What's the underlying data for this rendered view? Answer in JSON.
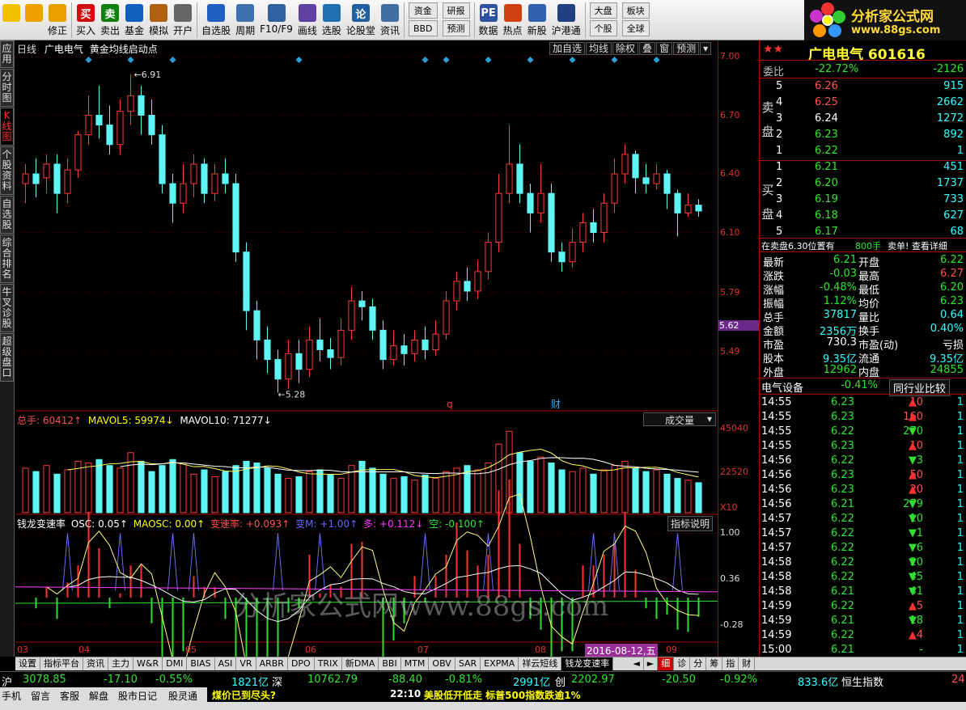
{
  "toolbar": {
    "buttons": [
      {
        "label": "",
        "icon": "start-grid-icon",
        "color": "#f2c200"
      },
      {
        "label": "",
        "icon": "back-arrow-icon",
        "color": "#f0a000"
      },
      {
        "label": "修正",
        "icon": "refresh-icon",
        "color": "#e8a000"
      },
      {
        "label": "买入",
        "icon": "buy-icon",
        "color": "#d01010",
        "glyph": "买"
      },
      {
        "label": "卖出",
        "icon": "sell-icon",
        "color": "#108010",
        "glyph": "卖"
      },
      {
        "label": "基金",
        "icon": "fund-icon",
        "color": "#1060c0"
      },
      {
        "label": "模拟",
        "icon": "hammer-icon",
        "color": "#b06010"
      },
      {
        "label": "开户",
        "icon": "lock-icon",
        "color": "#666"
      },
      {
        "label": "自选股",
        "icon": "star-folder-icon",
        "color": "#2060c0"
      },
      {
        "label": "周期",
        "icon": "clock-icon",
        "color": "#4070b0"
      },
      {
        "label": "F10/F9",
        "icon": "f10-icon",
        "color": "#3060a0"
      },
      {
        "label": "画线",
        "icon": "pen-icon",
        "color": "#6040a0"
      },
      {
        "label": "选股",
        "icon": "stock-pick-icon",
        "color": "#2070b0"
      },
      {
        "label": "论股堂",
        "icon": "forum-icon",
        "color": "#2060a0",
        "glyph": "论"
      },
      {
        "label": "资讯",
        "icon": "news-icon",
        "color": "#4070a0"
      }
    ],
    "small_buttons": [
      [
        "资金",
        "BBD"
      ],
      [
        "研报",
        "预测"
      ]
    ],
    "buttons2": [
      {
        "label": "数据",
        "icon": "pe-icon",
        "color": "#3050a0",
        "glyph": "PE"
      },
      {
        "label": "热点",
        "icon": "hot-icon",
        "color": "#d04010"
      },
      {
        "label": "新股",
        "icon": "new-stock-icon",
        "color": "#3060b0"
      },
      {
        "label": "沪港通",
        "icon": "hk-connect-icon",
        "color": "#204080"
      }
    ],
    "small_buttons2": [
      [
        "大盘",
        "个股"
      ],
      [
        "板块",
        "全球"
      ]
    ]
  },
  "logo": {
    "line1": "分析家公式网",
    "line2": "www.88gs.com"
  },
  "side_tabs": [
    "应用",
    "分时图",
    "K线图",
    "个股资料",
    "自选股",
    "综合排名",
    "牛叉诊股",
    "超级盘口"
  ],
  "chart_header": {
    "period": "日线",
    "stock": "广电电气",
    "formula": "黄金均线启动点"
  },
  "chart_buttons": [
    "加自选",
    "均线",
    "除权",
    "叠",
    "窗",
    "预测"
  ],
  "kline": {
    "high_label": "6.91",
    "low_label": "5.28",
    "price_axis": [
      "7.00",
      "6.70",
      "6.40",
      "6.10",
      "5.79",
      "5.49"
    ],
    "current_marker": "5.62",
    "event_q": "q",
    "event_cai": "财",
    "candles": [
      [
        6.35,
        6.4,
        6.45,
        6.25
      ],
      [
        6.4,
        6.35,
        6.48,
        6.28
      ],
      [
        6.38,
        6.45,
        6.5,
        6.3
      ],
      [
        6.45,
        6.3,
        6.5,
        6.2
      ],
      [
        6.3,
        6.42,
        6.48,
        6.25
      ],
      [
        6.42,
        6.6,
        6.62,
        6.38
      ],
      [
        6.6,
        6.7,
        6.8,
        6.55
      ],
      [
        6.7,
        6.65,
        6.85,
        6.58
      ],
      [
        6.65,
        6.55,
        6.75,
        6.5
      ],
      [
        6.55,
        6.72,
        6.78,
        6.5
      ],
      [
        6.72,
        6.8,
        6.91,
        6.65
      ],
      [
        6.8,
        6.7,
        6.85,
        6.6
      ],
      [
        6.7,
        6.6,
        6.78,
        6.55
      ],
      [
        6.6,
        6.35,
        6.65,
        6.3
      ],
      [
        6.35,
        6.25,
        6.4,
        6.15
      ],
      [
        6.25,
        6.35,
        6.45,
        6.2
      ],
      [
        6.35,
        6.45,
        6.5,
        6.28
      ],
      [
        6.45,
        6.3,
        6.48,
        6.25
      ],
      [
        6.3,
        6.4,
        6.45,
        6.26
      ],
      [
        6.4,
        6.35,
        6.48,
        6.3
      ],
      [
        6.35,
        6.0,
        6.4,
        5.95
      ],
      [
        6.0,
        5.7,
        6.05,
        5.6
      ],
      [
        5.7,
        5.55,
        5.75,
        5.45
      ],
      [
        5.55,
        5.45,
        5.62,
        5.38
      ],
      [
        5.45,
        5.35,
        5.5,
        5.28
      ],
      [
        5.35,
        5.48,
        5.55,
        5.3
      ],
      [
        5.48,
        5.4,
        5.55,
        5.33
      ],
      [
        5.4,
        5.55,
        5.62,
        5.36
      ],
      [
        5.55,
        5.5,
        5.66,
        5.44
      ],
      [
        5.5,
        5.46,
        5.56,
        5.4
      ],
      [
        5.46,
        5.6,
        5.66,
        5.42
      ],
      [
        5.6,
        5.75,
        5.82,
        5.55
      ],
      [
        5.75,
        5.72,
        5.8,
        5.65
      ],
      [
        5.72,
        5.6,
        5.76,
        5.55
      ],
      [
        5.6,
        5.45,
        5.65,
        5.4
      ],
      [
        5.45,
        5.52,
        5.6,
        5.42
      ],
      [
        5.52,
        5.48,
        5.58,
        5.42
      ],
      [
        5.48,
        5.55,
        5.6,
        5.44
      ],
      [
        5.55,
        5.5,
        5.62,
        5.45
      ],
      [
        5.5,
        5.58,
        5.65,
        5.47
      ],
      [
        5.58,
        5.75,
        5.8,
        5.55
      ],
      [
        5.75,
        5.85,
        5.9,
        5.7
      ],
      [
        5.85,
        5.8,
        5.92,
        5.75
      ],
      [
        5.8,
        5.9,
        5.96,
        5.76
      ],
      [
        5.9,
        6.05,
        6.1,
        5.86
      ],
      [
        6.05,
        6.3,
        6.4,
        6.0
      ],
      [
        6.3,
        6.45,
        6.65,
        6.25
      ],
      [
        6.45,
        6.3,
        6.55,
        6.25
      ],
      [
        6.3,
        6.2,
        6.35,
        6.1
      ],
      [
        6.2,
        6.3,
        6.45,
        6.15
      ],
      [
        6.3,
        6.0,
        6.35,
        5.95
      ],
      [
        6.0,
        5.95,
        6.05,
        5.9
      ],
      [
        5.95,
        6.05,
        6.12,
        5.92
      ],
      [
        6.05,
        6.15,
        6.2,
        6.0
      ],
      [
        6.15,
        6.1,
        6.22,
        6.05
      ],
      [
        6.1,
        6.25,
        6.3,
        6.05
      ],
      [
        6.25,
        6.4,
        6.48,
        6.2
      ],
      [
        6.4,
        6.5,
        6.55,
        6.35
      ],
      [
        6.5,
        6.38,
        6.52,
        6.3
      ],
      [
        6.38,
        6.35,
        6.45,
        6.3
      ],
      [
        6.35,
        6.4,
        6.45,
        6.32
      ],
      [
        6.4,
        6.3,
        6.42,
        6.22
      ],
      [
        6.3,
        6.2,
        6.32,
        6.08
      ],
      [
        6.2,
        6.24,
        6.3,
        6.18
      ],
      [
        6.24,
        6.21,
        6.27,
        6.18
      ]
    ],
    "volumes": [
      52,
      48,
      55,
      45,
      50,
      60,
      58,
      62,
      55,
      52,
      70,
      60,
      48,
      55,
      62,
      58,
      45,
      50,
      42,
      48,
      55,
      60,
      58,
      52,
      45,
      40,
      42,
      48,
      50,
      44,
      40,
      55,
      60,
      52,
      45,
      40,
      42,
      38,
      44,
      40,
      48,
      52,
      55,
      50,
      58,
      80,
      95,
      70,
      60,
      65,
      58,
      50,
      48,
      52,
      45,
      50,
      55,
      60,
      52,
      48,
      50,
      45,
      40,
      38,
      35
    ]
  },
  "volume_panel": {
    "total": "总手: 60412↑",
    "mavol5": "MAVOL5: 59974↓",
    "mavol10": "MAVOL10: 71277↓",
    "dropdown": "成交量",
    "axis": [
      "45040",
      "22520"
    ],
    "unit": "X10"
  },
  "osc_panel": {
    "name": "钱龙变速率",
    "osc": "OSC: 0.05↑",
    "maosc": "MAOSC: 0.00↑",
    "bsl": "变速率: +0.093↑",
    "bm": "变M: +1.00↑",
    "duo": "多: +0.112↓",
    "kong": "空: -0.100↑",
    "help": "指标说明",
    "axis": [
      "1.00",
      "0.36",
      "-0.28"
    ],
    "watermark": "分析家公式网www.88gs.com"
  },
  "date_axis": [
    "03",
    "04",
    "05",
    "06",
    "07",
    "08",
    "09"
  ],
  "date_marker": "2016-08-12,五",
  "quote": {
    "name": "广电电气",
    "code": "601616",
    "weibi_label": "委比",
    "weibi": "-22.72%",
    "weicha": "-2126",
    "sell_label": "卖盘",
    "buy_label": "买盘",
    "asks": [
      [
        "5",
        "6.26",
        "915"
      ],
      [
        "4",
        "6.25",
        "2662"
      ],
      [
        "3",
        "6.24",
        "1272"
      ],
      [
        "2",
        "6.23",
        "892"
      ],
      [
        "1",
        "6.22",
        "1"
      ]
    ],
    "bids": [
      [
        "1",
        "6.21",
        "451"
      ],
      [
        "2",
        "6.20",
        "1737"
      ],
      [
        "3",
        "6.19",
        "733"
      ],
      [
        "4",
        "6.18",
        "627"
      ],
      [
        "5",
        "6.17",
        "68"
      ]
    ],
    "notice": "在卖盘6.30位置有",
    "notice_vol": "800手",
    "notice_tail": "卖单! 查看详细",
    "stats": [
      [
        "最新",
        "6.21",
        "开盘",
        "6.22"
      ],
      [
        "涨跌",
        "-0.03",
        "最高",
        "6.27"
      ],
      [
        "涨幅",
        "-0.48%",
        "最低",
        "6.20"
      ],
      [
        "振幅",
        "1.12%",
        "均价",
        "6.23"
      ],
      [
        "总手",
        "37817",
        "量比",
        "0.64"
      ],
      [
        "金额",
        "2356万",
        "换手",
        "0.40%"
      ],
      [
        "市盈",
        "730.3",
        "市盈(动)",
        "亏损"
      ],
      [
        "股本",
        "9.35亿",
        "流通",
        "9.35亿"
      ],
      [
        "外盘",
        "12962",
        "内盘",
        "24855"
      ]
    ],
    "industry": "电气设备",
    "industry_chg": "-0.41%",
    "compare": "同行业比较"
  },
  "ticks": [
    [
      "14:55",
      "6.23",
      "10",
      "up"
    ],
    [
      "14:55",
      "6.23",
      "160",
      "up"
    ],
    [
      "14:55",
      "6.22",
      "270",
      "down"
    ],
    [
      "14:55",
      "6.23",
      "10",
      "up"
    ],
    [
      "14:56",
      "6.22",
      "3",
      "down"
    ],
    [
      "14:56",
      "6.23",
      "50",
      "up"
    ],
    [
      "14:56",
      "6.23",
      "20",
      "up"
    ],
    [
      "14:56",
      "6.21",
      "279",
      "down"
    ],
    [
      "14:57",
      "6.22",
      "10",
      "down"
    ],
    [
      "14:57",
      "6.22",
      "1",
      "down"
    ],
    [
      "14:57",
      "6.22",
      "6",
      "down"
    ],
    [
      "14:58",
      "6.22",
      "20",
      "down"
    ],
    [
      "14:58",
      "6.22",
      "45",
      "down"
    ],
    [
      "14:58",
      "6.21",
      "41",
      "down"
    ],
    [
      "14:59",
      "6.22",
      "5",
      "up"
    ],
    [
      "14:59",
      "6.21",
      "18",
      "down"
    ],
    [
      "14:59",
      "6.22",
      "4",
      "up"
    ],
    [
      "15:00",
      "6.21",
      "-",
      ""
    ]
  ],
  "bottom_tabs": [
    "设置",
    "指标平台",
    "资讯",
    "主力",
    "W&R",
    "DMI",
    "BIAS",
    "ASI",
    "VR",
    "ARBR",
    "DPO",
    "TRIX",
    "新DMA",
    "BBI",
    "MTM",
    "OBV",
    "SAR",
    "EXPMA",
    "祥云短线",
    "钱龙变速率"
  ],
  "right_tabs": [
    "细",
    "诊",
    "分",
    "筹",
    "指",
    "财"
  ],
  "index_bar": {
    "sh": "沪",
    "sh_val": "3078.85",
    "sh_chg": "-17.10",
    "sh_pct": "-0.55%",
    "sh_amt": "1821亿",
    "sz": "深",
    "sz_val": "10762.79",
    "sz_chg": "-88.40",
    "sz_pct": "-0.81%",
    "sz_amt": "2991亿",
    "cy": "创",
    "cy_val": "2202.97",
    "cy_chg": "-20.50",
    "cy_pct": "-0.92%",
    "cy_amt": "833.6亿",
    "hs": "恒生指数",
    "tail": "24"
  },
  "status_bar": {
    "items": [
      "手机",
      "留言",
      "客服",
      "解盘",
      "股市日记",
      "股灵通",
      "行情",
      "24小时滚动"
    ],
    "news1": "煤价已到尽头?",
    "news_time": "22:10",
    "news2": "美股低开低走 标普500指数跌逾1%"
  }
}
